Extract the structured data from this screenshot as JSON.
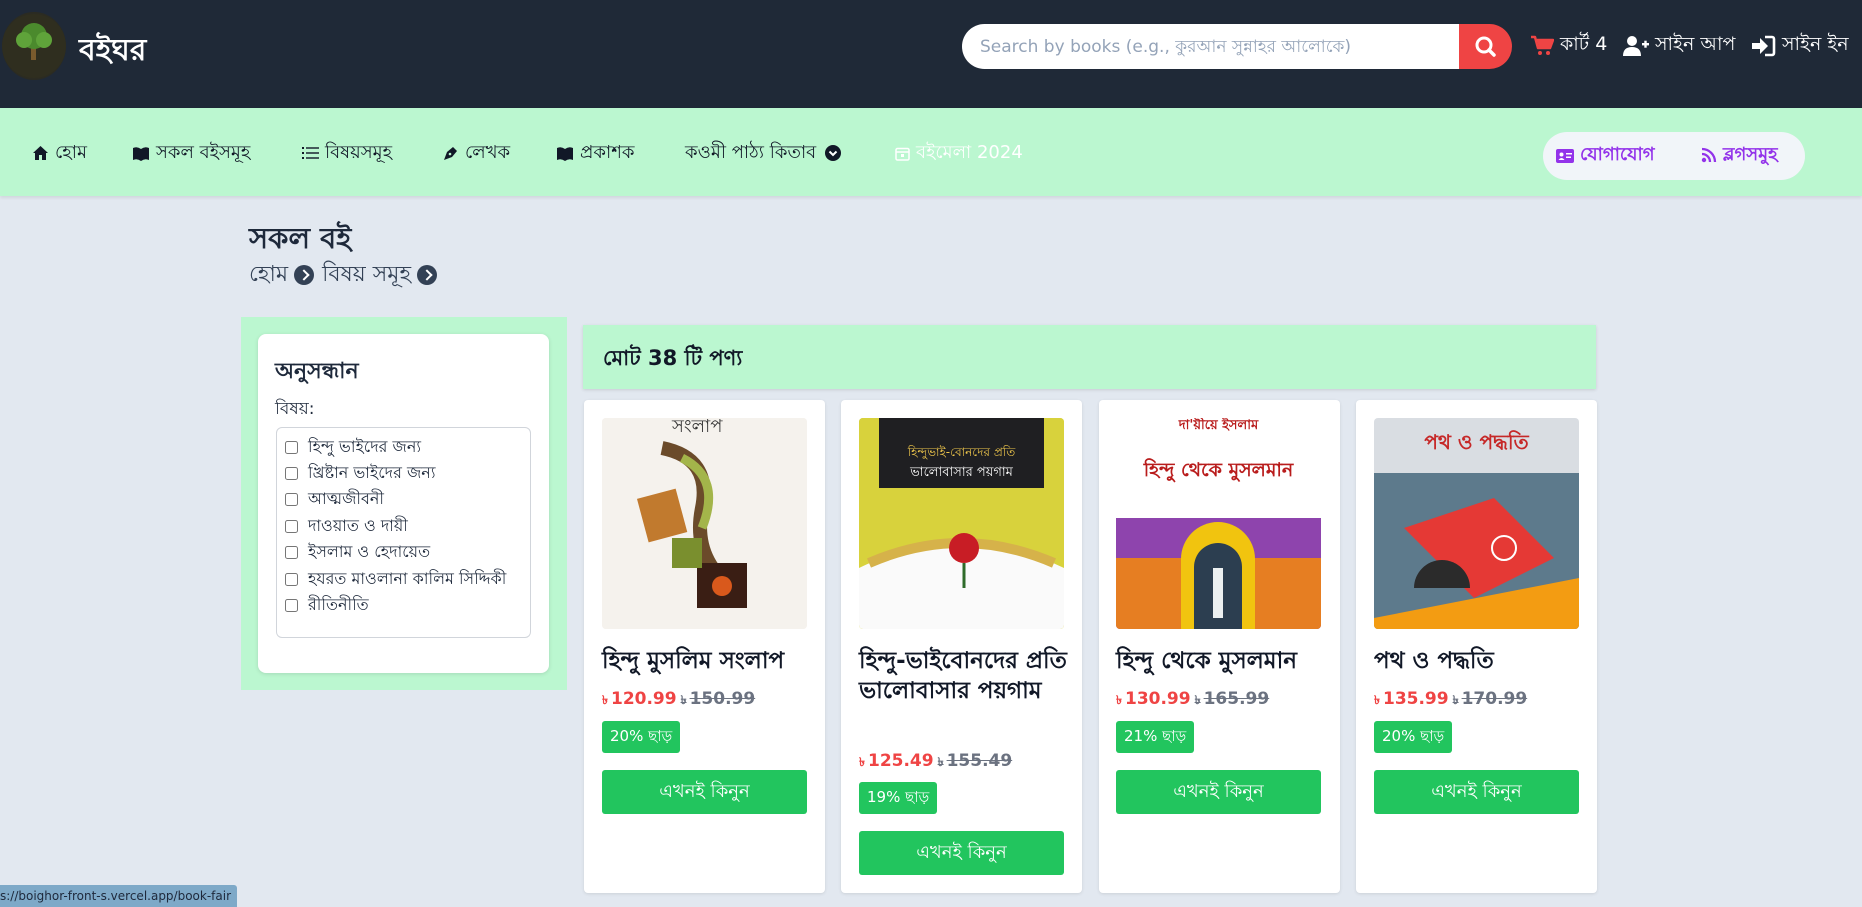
{
  "header": {
    "brand": "বইঘর",
    "search_placeholder": "Search by books (e.g., কুরআন সুন্নাহর আলোকে)",
    "cart_label": "কার্ট 4",
    "signup_label": "সাইন আপ",
    "signin_label": "সাইন ইন"
  },
  "nav": {
    "items": [
      {
        "label": "হোম"
      },
      {
        "label": "সকল বইসমূহ"
      },
      {
        "label": "বিষয়সমূহ"
      },
      {
        "label": "লেখক"
      },
      {
        "label": "প্রকাশক"
      },
      {
        "label": "কওমী পাঠ্য কিতাব"
      },
      {
        "label": "বইমেলা 2024"
      }
    ],
    "contact_label": "যোগাযোগ",
    "blogs_label": "ব্লগসমুহ"
  },
  "page": {
    "title": "সকল বই",
    "breadcrumb": [
      "হোম",
      "বিষয় সমূহ"
    ]
  },
  "filter": {
    "title": "অনুসন্ধান",
    "subject_label": "বিষয়:",
    "options": [
      "হিন্দু ভাইদের জন্য",
      "খ্রিষ্টান ভাইদের জন্য",
      "আত্মজীবনী",
      "দাওয়াত ও দায়ী",
      "ইসলাম ও হেদায়েত",
      "হযরত মাওলানা কালিম সিদ্দিকী",
      "রীতিনীতি"
    ]
  },
  "products": {
    "total_label": "মোট 38 টি পণ্য",
    "currency": "৳",
    "buy_label": "এখনই কিনুন",
    "items": [
      {
        "title": "হিন্দু মুসলিম সংলাপ",
        "price": "120.99",
        "old_price": "150.99",
        "discount": "20% ছাড়"
      },
      {
        "title": "হিন্দু-ভাইবোনদের প্রতি ভালোবাসার পয়গাম",
        "price": "125.49",
        "old_price": "155.49",
        "discount": "19% ছাড়"
      },
      {
        "title": "হিন্দু থেকে মুসলমান",
        "price": "130.99",
        "old_price": "165.99",
        "discount": "21% ছাড়"
      },
      {
        "title": "পথ ও পদ্ধতি",
        "price": "135.99",
        "old_price": "170.99",
        "discount": "20% ছাড়"
      }
    ]
  },
  "cover_text": {
    "c1": "সংলাপ",
    "c2_top": "হিন্দুভাই-বোনদের প্রতি",
    "c2_bottom": "ভালোবাসার পয়গাম",
    "c3_top": "দা'য়ীয়ে ইসলাম",
    "c3_title": "হিন্দু থেকে মুসলমান",
    "c4_title": "পথ ও পদ্ধতি"
  },
  "status_bar": {
    "url": "s://boighor-front-s.vercel.app/book-fair"
  },
  "colors": {
    "header_bg": "#1f2937",
    "nav_bg": "#bbf7d0",
    "accent_red": "#ef4444",
    "accent_green": "#22c55e",
    "accent_purple": "#9333ea"
  }
}
